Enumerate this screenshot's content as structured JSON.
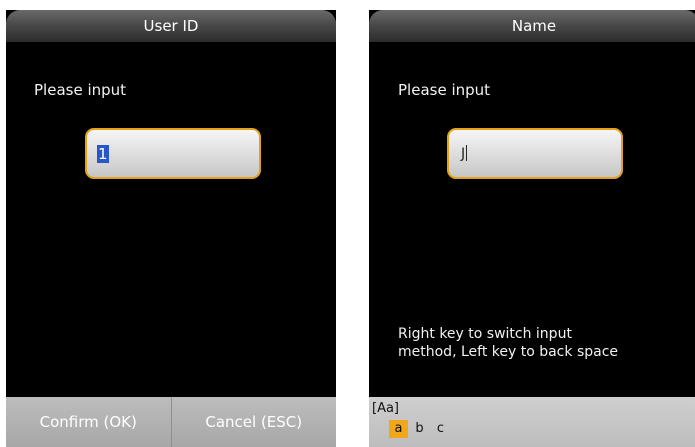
{
  "user_id_screen": {
    "title": "User ID",
    "prompt": "Please input",
    "value": "1",
    "confirm_label": "Confirm (OK)",
    "cancel_label": "Cancel (ESC)"
  },
  "name_screen": {
    "title": "Name",
    "prompt": "Please input",
    "value": "J",
    "hint_line1": "Right key to switch input",
    "hint_line2": "method, Left key to back space",
    "ime": {
      "mode": "[Aa]",
      "candidates": [
        "a",
        "b",
        "c"
      ],
      "selected": "a"
    }
  },
  "colors": {
    "screen_bg": "#000000",
    "input_border": "#e3a21a",
    "selection": "#2857c7",
    "ime_highlight": "#f2a61a"
  }
}
